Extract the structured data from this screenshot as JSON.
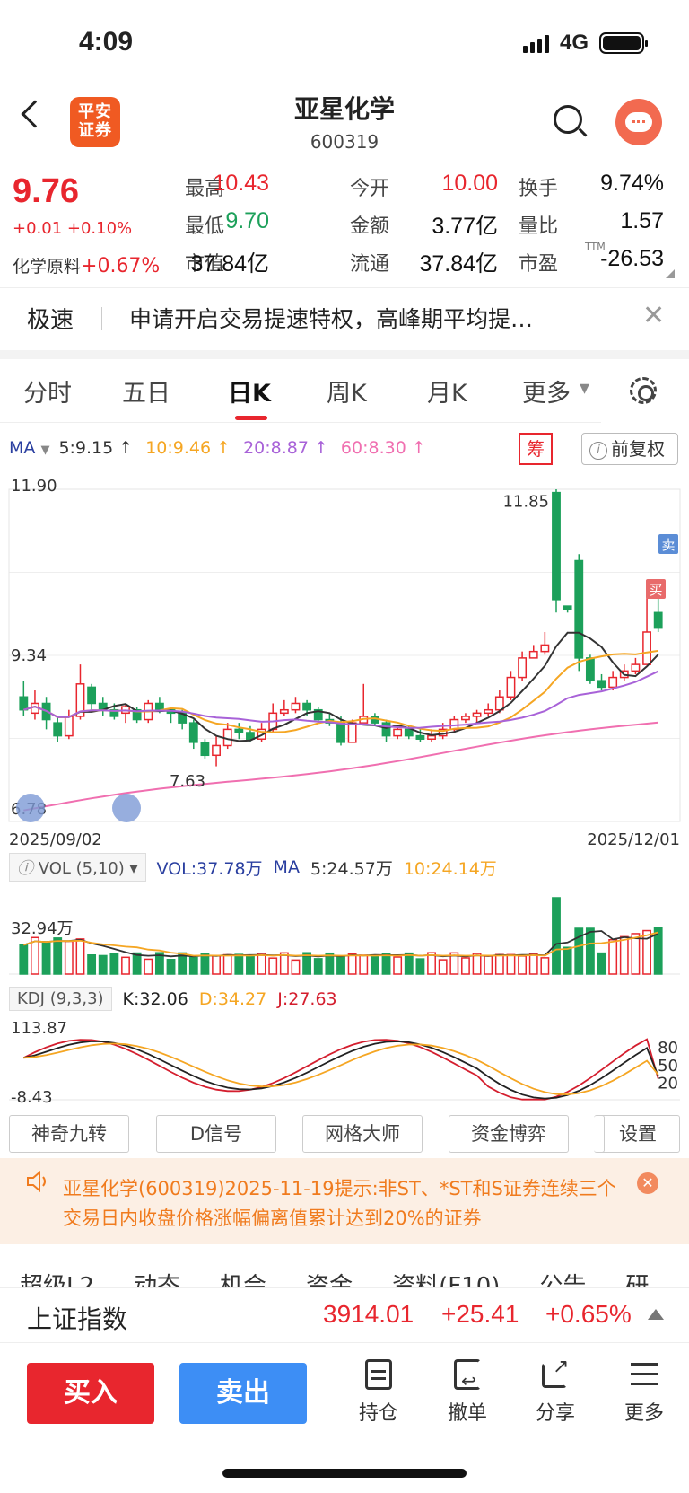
{
  "status": {
    "time": "4:09",
    "network": "4G"
  },
  "header": {
    "broker_logo": "平安\n证券",
    "name": "亚星化学",
    "code": "600319"
  },
  "quote": {
    "price": "9.76",
    "change": "+0.01 +0.10%",
    "sector_label": "化学原料",
    "sector_change": "+0.67%",
    "fields": [
      {
        "label": "最高",
        "value": "10.43",
        "color": "red"
      },
      {
        "label": "今开",
        "value": "10.00",
        "color": "red"
      },
      {
        "label": "换手",
        "value": "9.74%",
        "color": "black"
      },
      {
        "label": "最低",
        "value": "9.70",
        "color": "green"
      },
      {
        "label": "金额",
        "value": "3.77亿",
        "color": "black"
      },
      {
        "label": "量比",
        "value": "1.57",
        "color": "black"
      },
      {
        "label": "市值",
        "value": "37.84亿",
        "color": "black"
      },
      {
        "label": "流通",
        "value": "37.84亿",
        "color": "black"
      },
      {
        "label": "市盈",
        "value": "-26.53",
        "color": "black"
      }
    ],
    "pe_sup": "TTM"
  },
  "notice": {
    "tag": "极速",
    "text": "申请开启交易提速特权，高峰期平均提…",
    "close": "✕"
  },
  "tabs": [
    "分时",
    "五日",
    "日K",
    "周K",
    "月K",
    "更多"
  ],
  "active_tab": "日K",
  "ma_legend": {
    "label": "MA",
    "items": [
      {
        "text": "5:9.15",
        "color": "#333333"
      },
      {
        "text": "10:9.46",
        "color": "#f5a623"
      },
      {
        "text": "20:8.87",
        "color": "#a862d8"
      },
      {
        "text": "60:8.30",
        "color": "#f06fb0"
      }
    ]
  },
  "chip_label": "筹",
  "adjust_label": "前复权",
  "kline": {
    "y_max_label": "11.90",
    "y_mid_label": "9.34",
    "y_min_label": "6.78",
    "start_date": "2025/09/02",
    "end_date": "2025/12/01",
    "high_marker": "11.85",
    "low_marker": "7.63",
    "sell_tag": "卖",
    "buy_tag": "买"
  },
  "volume": {
    "selector": "VOL (5,10)",
    "vol_text": "VOL:37.78万",
    "ma_label": "MA",
    "ma5_text": "5:24.57万",
    "ma10_text": "10:24.14万",
    "max_label": "32.94万"
  },
  "kdj": {
    "selector": "KDJ (9,3,3)",
    "k_text": "K:32.06",
    "d_text": "D:34.27",
    "j_text": "J:27.63",
    "top_label": "113.87",
    "bottom_label": "-8.43",
    "lvl80": "80",
    "lvl50": "50",
    "lvl20": "20"
  },
  "indicator_buttons": [
    "神奇九转",
    "D信号",
    "网格大师",
    "资金博弈",
    "设置"
  ],
  "alert": {
    "text": "亚星化学(600319)2025-11-19提示:非ST、*ST和S证券连续三个交易日内收盘价格涨幅偏离值累计达到20%的证券"
  },
  "sub_tabs": [
    "超级L2",
    "动态",
    "机会",
    "资金",
    "资料(F10)",
    "公告",
    "研"
  ],
  "index_bar": {
    "name": "上证指数",
    "value": "3914.01",
    "change": "+25.41",
    "pct": "+0.65%"
  },
  "actions": {
    "buy": "买入",
    "sell": "卖出",
    "items": [
      "持仓",
      "撤单",
      "分享",
      "更多"
    ]
  },
  "colors": {
    "up": "#e8262e",
    "down": "#1ca05a",
    "sell_blue": "#3d8ef5",
    "alert_orange": "#f07b1e"
  }
}
